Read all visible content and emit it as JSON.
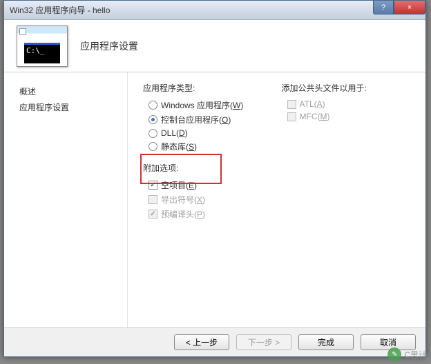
{
  "window": {
    "title": "Win32 应用程序向导 - hello",
    "help": "?",
    "close": "×"
  },
  "header": {
    "icon_text": "C:\\_",
    "title": "应用程序设置"
  },
  "sidebar": {
    "items": [
      {
        "label": "概述"
      },
      {
        "label": "应用程序设置"
      }
    ]
  },
  "content": {
    "app_type": {
      "label": "应用程序类型:",
      "options": [
        {
          "label": "Windows 应用程序(",
          "key": "W",
          "label_after": ")",
          "selected": false
        },
        {
          "label": "控制台应用程序(",
          "key": "O",
          "label_after": ")",
          "selected": true
        },
        {
          "label": "DLL(",
          "key": "D",
          "label_after": ")",
          "selected": false
        },
        {
          "label": "静态库(",
          "key": "S",
          "label_after": ")",
          "selected": false
        }
      ]
    },
    "extra": {
      "label": "附加选项:",
      "options": [
        {
          "label": "空项目(",
          "key": "E",
          "label_after": ")",
          "checked": true,
          "disabled": false
        },
        {
          "label": "导出符号(",
          "key": "X",
          "label_after": ")",
          "checked": false,
          "disabled": true
        },
        {
          "label": "预编译头(",
          "key": "P",
          "label_after": ")",
          "checked": true,
          "disabled": true
        }
      ]
    },
    "headers": {
      "label": "添加公共头文件以用于:",
      "options": [
        {
          "label": "ATL(",
          "key": "A",
          "label_after": ")",
          "checked": false,
          "disabled": true
        },
        {
          "label": "MFC(",
          "key": "M",
          "label_after": ")",
          "checked": false,
          "disabled": true
        }
      ]
    }
  },
  "footer": {
    "prev": "< 上一步",
    "next": "下一步 >",
    "finish": "完成",
    "cancel": "取消"
  },
  "watermark": "C思计"
}
